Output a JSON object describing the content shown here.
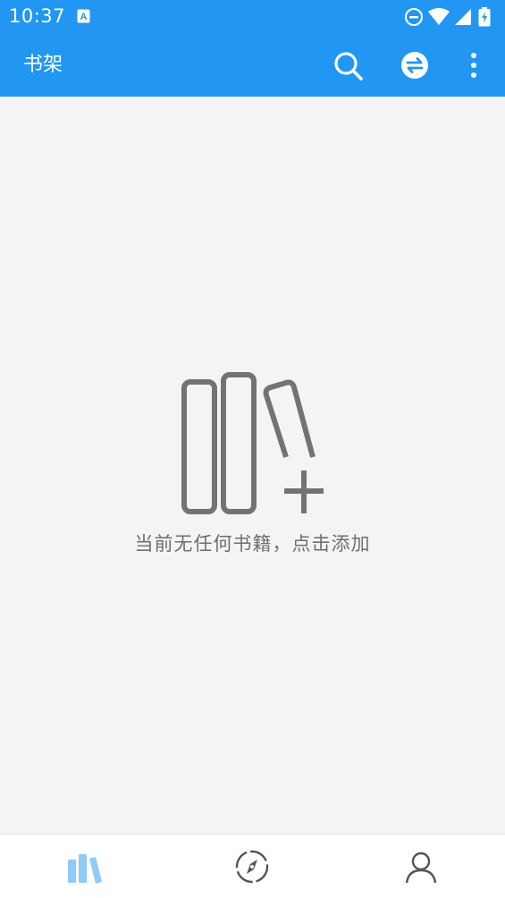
{
  "status_bar": {
    "time": "10:37",
    "background": "#2196f3",
    "icons": [
      "accessibility-a-icon",
      "do-not-disturb-icon",
      "wifi-icon",
      "signal-icon",
      "battery-charging-icon"
    ]
  },
  "app_bar": {
    "title": "书架",
    "background": "#2196f3",
    "actions": [
      "search-icon",
      "sync-icon",
      "more-vert-icon"
    ]
  },
  "empty_state": {
    "message": "当前无任何书籍，点击添加",
    "icon": "bookshelf-add-icon"
  },
  "bottom_nav": {
    "items": [
      {
        "icon": "bookshelf-icon",
        "active": true,
        "color": "#90caf9"
      },
      {
        "icon": "compass-icon",
        "active": false,
        "color": "#555555"
      },
      {
        "icon": "person-icon",
        "active": false,
        "color": "#555555"
      }
    ]
  }
}
